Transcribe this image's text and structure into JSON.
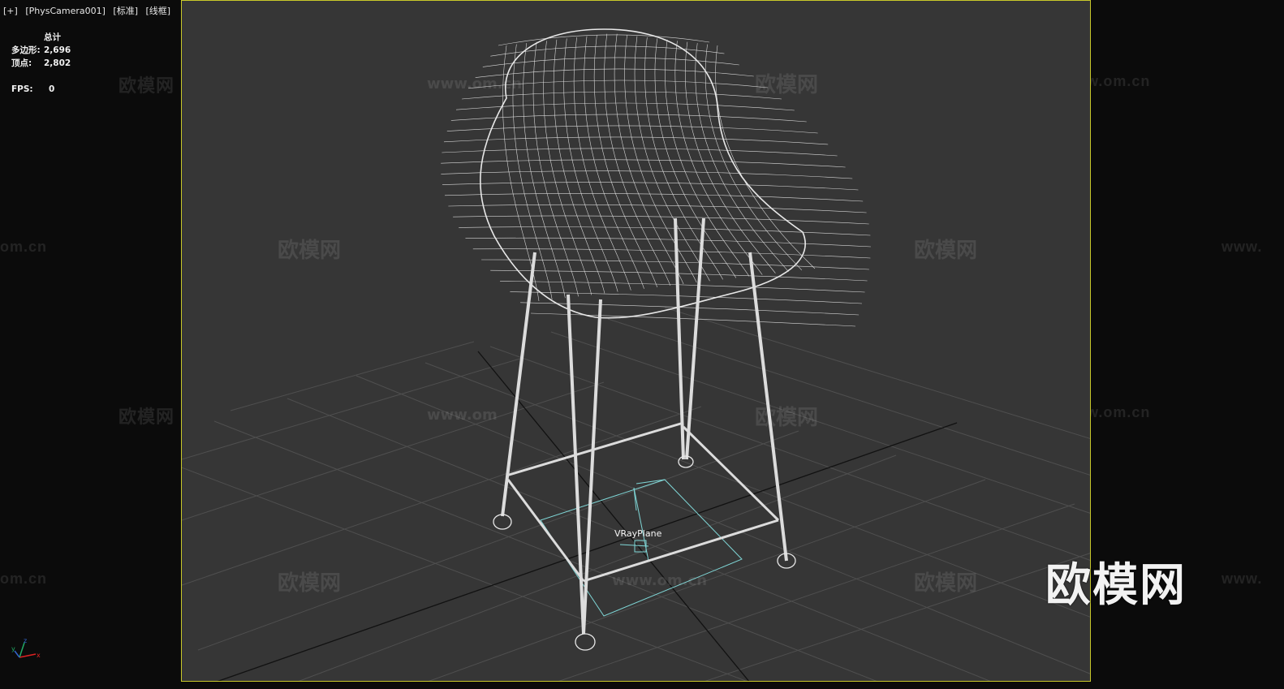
{
  "viewport_label": {
    "plus": "[+]",
    "camera": "[PhysCamera001]",
    "shading": "[标准]",
    "mode": "[线框]"
  },
  "stats": {
    "title": "总计",
    "polygons_label": "多边形:",
    "polygons_value": "2,696",
    "vertices_label": "顶点:",
    "vertices_value": "2,802",
    "fps_label": "FPS:",
    "fps_value": "0"
  },
  "scene": {
    "object_label": "VRayPlane",
    "grid_color": "#5a5a5a",
    "wire_color": "#e8e8e8",
    "plane_color": "#7fd6d6",
    "viewport_border_color": "#c9c92a"
  },
  "watermarks": {
    "brand": "欧模网",
    "url": "www.om.cn",
    "url_fragment": "om.cn",
    "url_prefix": "www.",
    "url_partial": "www.om",
    "big_logo": "欧模网"
  },
  "axis": {
    "x": "x",
    "y": "y",
    "z": "z"
  }
}
